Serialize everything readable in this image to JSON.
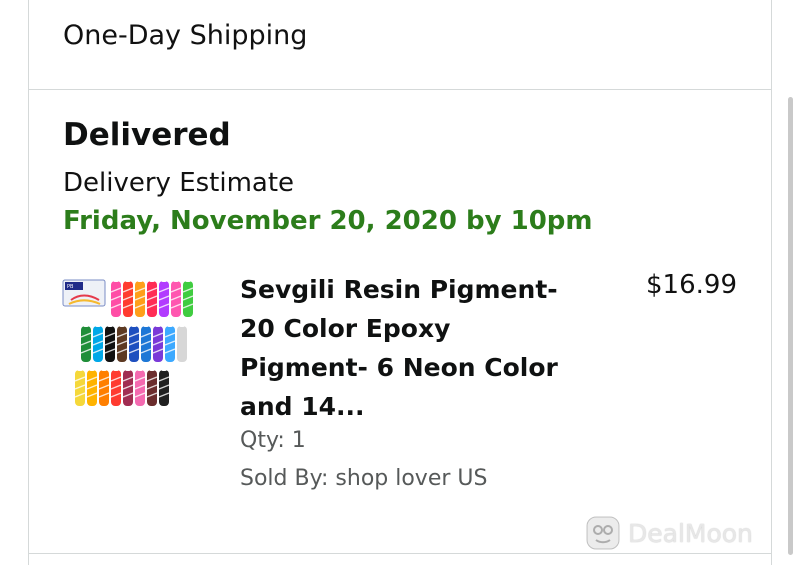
{
  "shipping": {
    "method": "One-Day Shipping"
  },
  "order": {
    "status": "Delivered",
    "estimate_label": "Delivery Estimate",
    "estimate_date": "Friday, November 20, 2020 by 10pm",
    "estimate_color": "#2c7d1b",
    "item": {
      "title": "Sevgili Resin Pigment- 20 Color Epoxy Pigment- 6 Neon Color and 14...",
      "price": "$16.99",
      "qty": "Qty: 1",
      "seller": "Sold By: shop lover US",
      "image_icon": "resin-pigment-bottles-image"
    }
  },
  "watermark": {
    "text": "DealMoon",
    "icon": "dealmoon-logo-icon"
  }
}
